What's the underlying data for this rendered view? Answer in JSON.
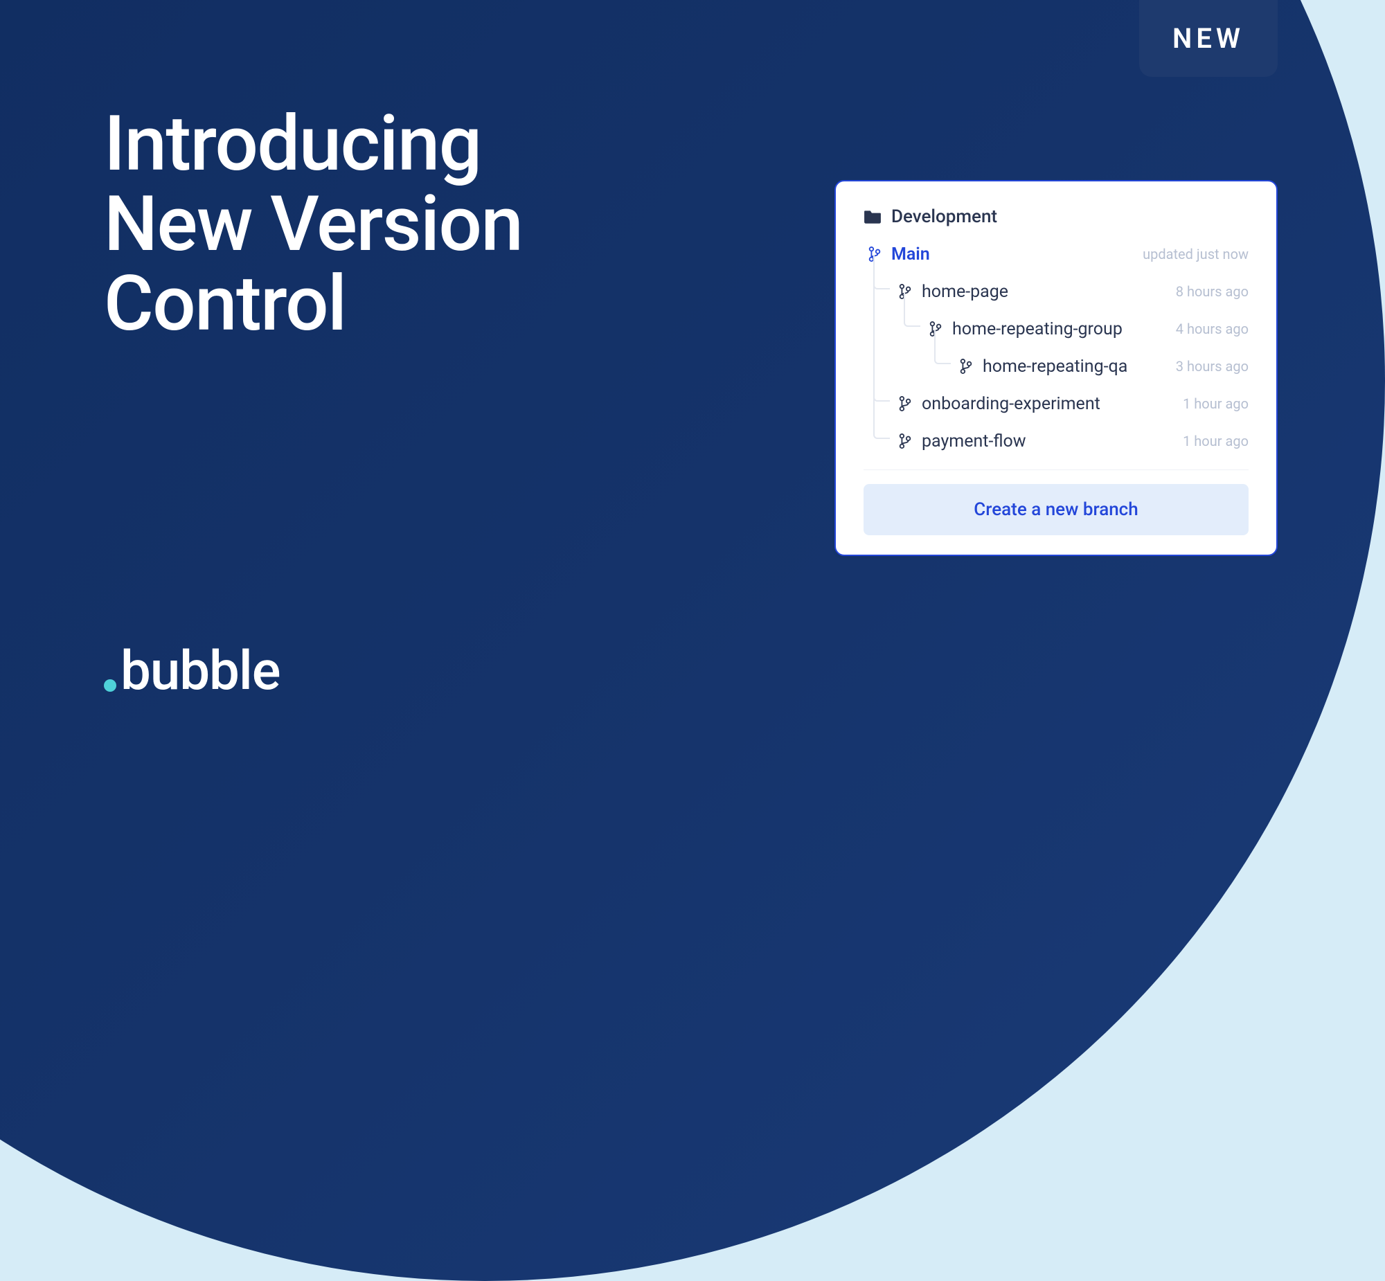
{
  "badge": {
    "label": "NEW"
  },
  "headline": {
    "line1": "Introducing",
    "line2": "New Version",
    "line3": "Control"
  },
  "brand": {
    "name": "bubble"
  },
  "panel": {
    "section_title": "Development",
    "main": {
      "name": "Main",
      "time": "updated just now"
    },
    "branches": [
      {
        "name": "home-page",
        "time": "8 hours ago",
        "indent": 1
      },
      {
        "name": "home-repeating-group",
        "time": "4 hours ago",
        "indent": 2
      },
      {
        "name": "home-repeating-qa",
        "time": "3 hours ago",
        "indent": 3
      },
      {
        "name": "onboarding-experiment",
        "time": "1 hour ago",
        "indent": 1
      },
      {
        "name": "payment-flow",
        "time": "1 hour ago",
        "indent": 1
      }
    ],
    "cta_label": "Create a new branch"
  },
  "colors": {
    "accent": "#2346d9",
    "bg_light": "#d6ecf7",
    "bg_dark": "#14336a"
  }
}
